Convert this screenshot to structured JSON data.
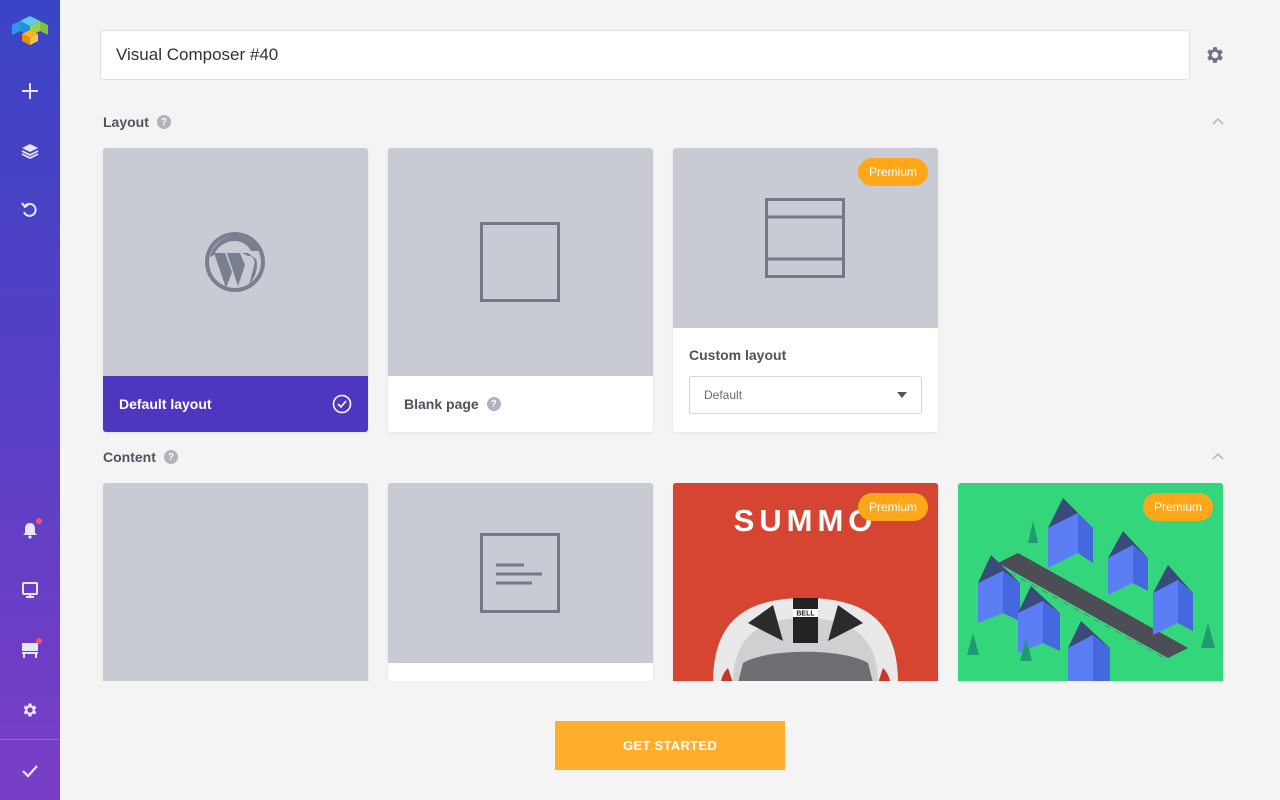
{
  "title_input": {
    "value": "Visual Composer #40"
  },
  "sections": {
    "layout": {
      "label": "Layout",
      "help": "?"
    },
    "content": {
      "label": "Content",
      "help": "?"
    }
  },
  "layout_cards": {
    "default": {
      "label": "Default layout",
      "selected": true
    },
    "blank": {
      "label": "Blank page",
      "help": "?"
    },
    "custom": {
      "label": "Custom layout",
      "badge": "Premium",
      "select_value": "Default"
    }
  },
  "content_cards": {
    "blank": {},
    "text": {},
    "summo": {
      "badge": "Premium",
      "text": "SUMMO",
      "helmet_text": "BELL"
    },
    "isometric": {
      "badge": "Premium"
    }
  },
  "cta": {
    "label": "GET STARTED"
  },
  "sidebar": {
    "icons": [
      "logo-icon",
      "plus-icon",
      "layers-icon",
      "undo-icon",
      "bell-icon",
      "monitor-icon",
      "hub-icon",
      "gear-icon",
      "check-icon"
    ]
  },
  "colors": {
    "sidebar_top": "#3b44c6",
    "sidebar_bottom": "#7a3ec6",
    "selected": "#4f36c0",
    "premium": "#ffa71a",
    "cta": "#ffae2e",
    "summo_bg": "#d64531",
    "iso_bg": "#33d67a"
  }
}
